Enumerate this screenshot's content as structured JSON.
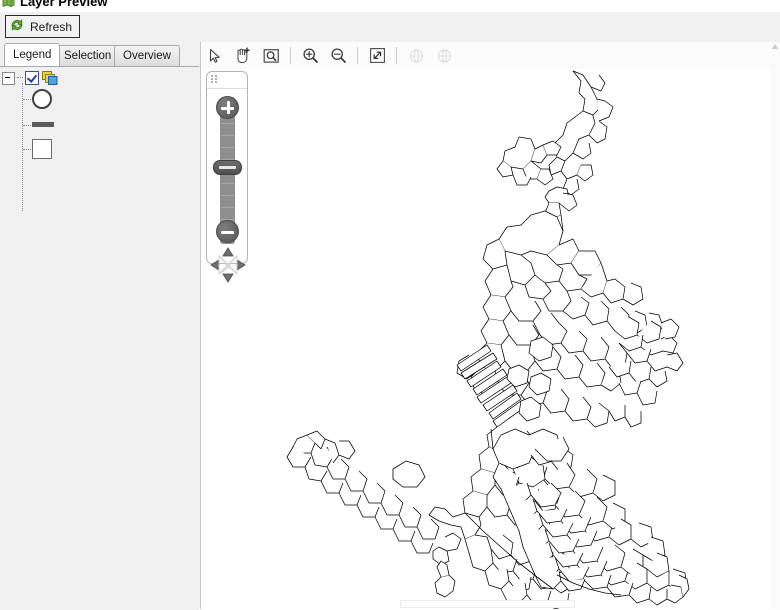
{
  "window": {
    "title": "Layer Preview",
    "icon": "map-window-icon"
  },
  "toolbar": {
    "refresh_label": "Refresh",
    "refresh_icon": "refresh-green-arrows-icon"
  },
  "panel": {
    "tabs": [
      {
        "label": "Legend",
        "name": "tab-legend",
        "active": true
      },
      {
        "label": "Selection",
        "name": "tab-selection",
        "active": false
      },
      {
        "label": "Overview",
        "name": "tab-overview",
        "active": false
      }
    ],
    "legend": {
      "root": {
        "expander": "collapse-expander",
        "checkbox_checked": true,
        "icon": "layers-stack-icon",
        "label": ""
      },
      "symbols": [
        {
          "name": "legend-symbol-point",
          "shape": "circle-outline",
          "label": ""
        },
        {
          "name": "legend-symbol-line",
          "shape": "thick-line",
          "label": ""
        },
        {
          "name": "legend-symbol-polygon",
          "shape": "square-outline",
          "label": ""
        }
      ]
    }
  },
  "map": {
    "tools": [
      {
        "name": "select-arrow-tool",
        "icon": "cursor-arrow-icon",
        "enabled": true
      },
      {
        "name": "pan-add-tool",
        "icon": "hand-plus-icon",
        "enabled": true
      },
      {
        "name": "zoom-to-selection-tool",
        "icon": "magnifier-box-icon",
        "enabled": true
      },
      {
        "name": "zoom-in-tool",
        "icon": "magnifier-plus-icon",
        "enabled": true
      },
      {
        "name": "zoom-out-tool",
        "icon": "magnifier-minus-icon",
        "enabled": true
      },
      {
        "name": "zoom-full-extent-tool",
        "icon": "expand-diagonal-icon",
        "enabled": true
      },
      {
        "name": "previous-extent-tool",
        "icon": "globe-left-icon",
        "enabled": false
      },
      {
        "name": "next-extent-tool",
        "icon": "globe-right-icon",
        "enabled": false
      }
    ],
    "nav": {
      "grip": "drag-grip-icon",
      "zoom_in": "zoom-in-plus-button",
      "zoom_out": "zoom-out-minus-button",
      "slider": "zoom-level-slider",
      "pan_pad": "pan-directional-pad"
    },
    "canvas": {
      "name": "map-canvas",
      "background": "#ffffff",
      "stroke": "#000000",
      "description": "administrative boundary polygons"
    }
  },
  "scroll": {
    "vertical": "vertical-scrollbar",
    "horizontal": "horizontal-scrollbar"
  },
  "colors": {
    "panel_bg": "#f0f0f0",
    "map_bg": "#ffffff",
    "tab_active_bg": "#ffffff",
    "accent_green": "#4f9b32"
  }
}
